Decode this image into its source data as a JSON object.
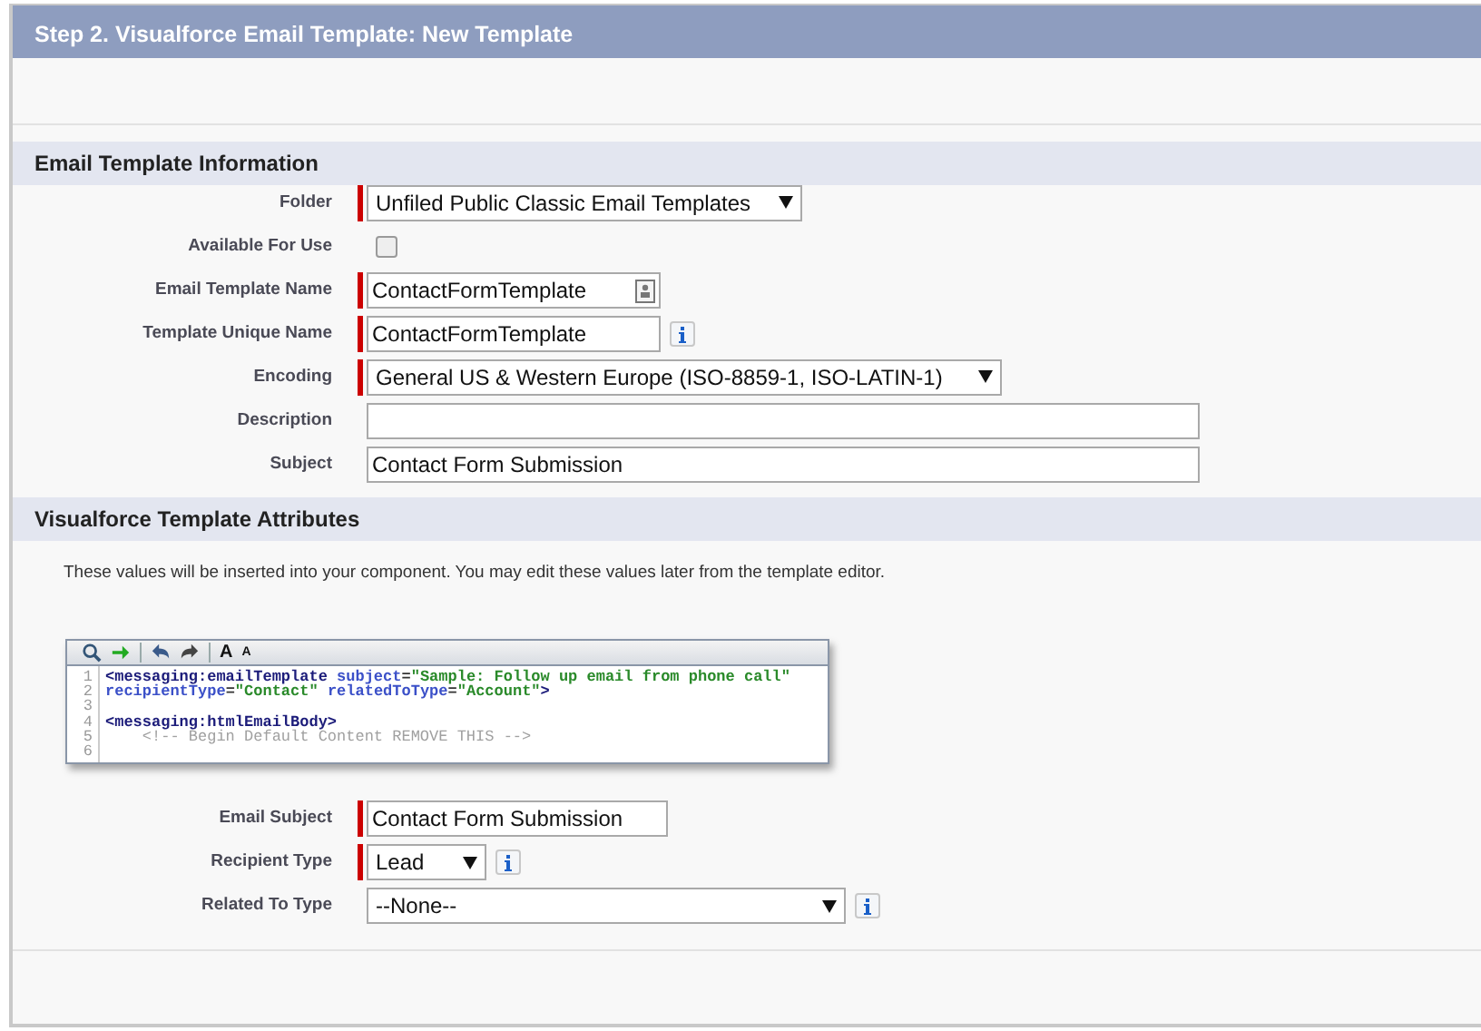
{
  "page_title": "Step 2. Visualforce Email Template: New Template",
  "sections": [
    {
      "title": "Email Template Information",
      "fields": [
        {
          "label": "Folder",
          "kind": "select",
          "value": "Unfiled Public Classic Email Templates",
          "required": true,
          "info": false
        },
        {
          "label": "Available For Use",
          "kind": "checkbox",
          "checked": false,
          "required": false,
          "info": false
        },
        {
          "label": "Email Template Name",
          "kind": "text",
          "value": "ContactFormTemplate",
          "required": true,
          "info": false,
          "autofill": true
        },
        {
          "label": "Template Unique Name",
          "kind": "text",
          "value": "ContactFormTemplate",
          "required": true,
          "info": true
        },
        {
          "label": "Encoding",
          "kind": "select",
          "value": "General US & Western Europe (ISO-8859-1, ISO-LATIN-1)",
          "required": true,
          "info": false
        },
        {
          "label": "Description",
          "kind": "text",
          "required": false,
          "info": false
        },
        {
          "label": "Subject",
          "kind": "text",
          "value": "Contact Form Submission",
          "required": false,
          "info": false
        }
      ]
    },
    {
      "title": "Visualforce Template Attributes",
      "intro": "These values will be inserted into your component. You may edit these values later from the template editor.",
      "editor": {
        "toolbar": [
          [
            {
              "kind": "search"
            },
            {
              "kind": "go"
            }
          ],
          [
            {
              "kind": "undo"
            },
            {
              "kind": "redo"
            }
          ],
          [
            {
              "kind": "font-larger",
              "text": "A"
            },
            {
              "kind": "font-smaller",
              "text": "A"
            }
          ]
        ],
        "lines": [
          {
            "number": "1",
            "tokens": [
              {
                "kind": "tag",
                "text": "<messaging:emailTemplate"
              },
              {
                "kind": "attr",
                "text": " subject"
              },
              {
                "kind": "plain",
                "text": "="
              },
              {
                "kind": "string",
                "text": "\"Sample: Follow up email from phone call\""
              }
            ]
          },
          {
            "number": "2",
            "tokens": [
              {
                "kind": "attr",
                "text": "recipientType"
              },
              {
                "kind": "plain",
                "text": "="
              },
              {
                "kind": "string",
                "text": "\"Contact\""
              },
              {
                "kind": "attr",
                "text": " relatedToType"
              },
              {
                "kind": "plain",
                "text": "="
              },
              {
                "kind": "string",
                "text": "\"Account\""
              },
              {
                "kind": "tag",
                "text": ">"
              }
            ]
          },
          {
            "number": "3"
          },
          {
            "number": "4",
            "tokens": [
              {
                "kind": "tag",
                "text": "<messaging:htmlEmailBody>"
              }
            ]
          },
          {
            "number": "5",
            "tokens": [
              {
                "kind": "comment",
                "text": "    <!-- Begin Default Content REMOVE THIS -->"
              }
            ]
          },
          {
            "number": "6"
          }
        ]
      },
      "fields": [
        {
          "label": "Email Subject",
          "kind": "text",
          "value": "Contact Form Submission",
          "required": true,
          "info": false
        },
        {
          "label": "Recipient Type",
          "kind": "select",
          "value": "Lead",
          "required": true,
          "info": true
        },
        {
          "label": "Related To Type",
          "kind": "select",
          "value": "--None--",
          "required": false,
          "info": true
        }
      ]
    }
  ]
}
